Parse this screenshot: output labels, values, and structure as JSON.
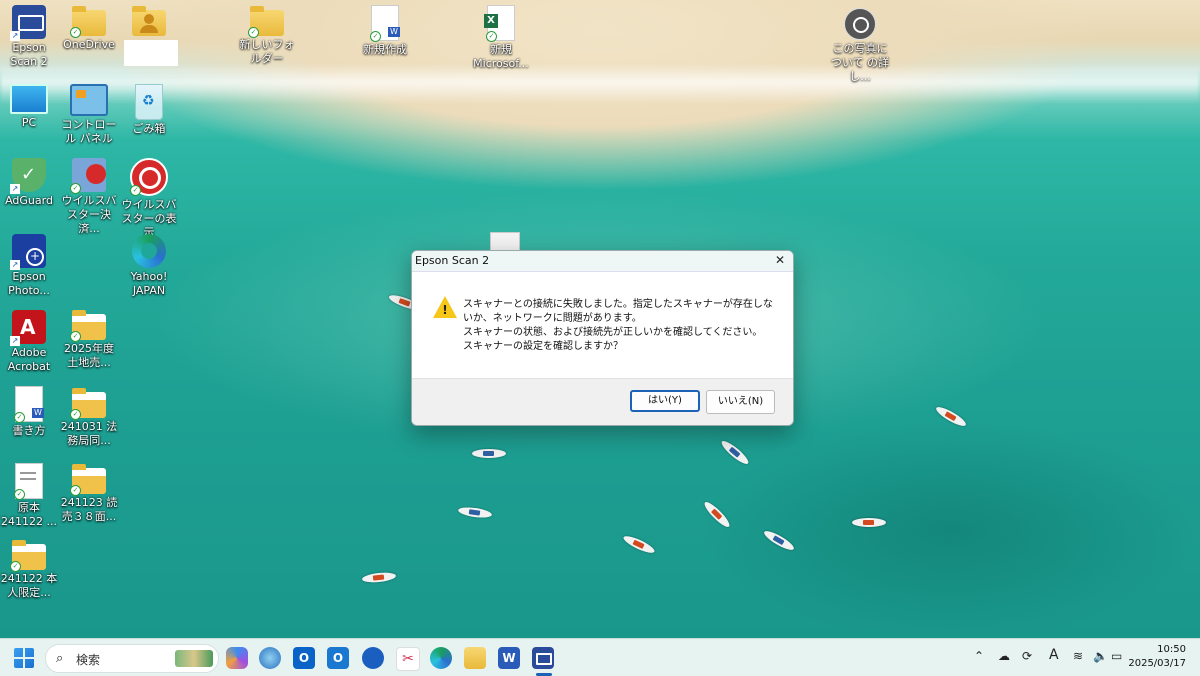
{
  "desktop": {
    "icons": [
      {
        "id": "epson-scan",
        "label": "Epson Scan 2"
      },
      {
        "id": "onedrive",
        "label": "OneDrive"
      },
      {
        "id": "new-folder",
        "label": "新しいフォルダー"
      },
      {
        "id": "new-doc",
        "label": "新規作成"
      },
      {
        "id": "new-excel",
        "label": "新規 Microsof..."
      },
      {
        "id": "photo-info",
        "label": "この写真について の詳し..."
      },
      {
        "id": "pc",
        "label": "PC"
      },
      {
        "id": "control-panel",
        "label": "コントロール パネル"
      },
      {
        "id": "recycle-bin",
        "label": "ごみ箱"
      },
      {
        "id": "adguard",
        "label": "AdGuard"
      },
      {
        "id": "virusbuster-pay",
        "label": "ウイルスバスター決済..."
      },
      {
        "id": "virusbuster-show",
        "label": "ウイルスバスターの表示"
      },
      {
        "id": "epson-photo",
        "label": "Epson Photo..."
      },
      {
        "id": "yahoo",
        "label": "Yahoo! JAPAN"
      },
      {
        "id": "adobe",
        "label": "Adobe Acrobat"
      },
      {
        "id": "folder-2025",
        "label": "2025年度 土地売..."
      },
      {
        "id": "kakikata",
        "label": "書き方"
      },
      {
        "id": "folder-241031",
        "label": "241031 法務局同..."
      },
      {
        "id": "gen-hon",
        "label": "原本 241122 ..."
      },
      {
        "id": "folder-241123",
        "label": "241123 読売３８面..."
      },
      {
        "id": "folder-241122",
        "label": "241122 本人限定..."
      }
    ]
  },
  "dialog": {
    "title": "Epson Scan 2",
    "close": "✕",
    "message_line1": "スキャナーとの接続に失敗しました。指定したスキャナーが存在しないか、ネットワークに問題があります。",
    "message_line2": "スキャナーの状態、および接続先が正しいかを確認してください。",
    "message_line3": "スキャナーの設定を確認しますか？",
    "yes_label": "はい(Y)",
    "no_label": "いいえ(N)"
  },
  "taskbar": {
    "search_placeholder": "検索",
    "ime_label": "A",
    "time": "10:50",
    "date": "2025/03/17"
  },
  "colors": {
    "accent": "#1c63b7",
    "warning": "#f6c619",
    "taskbar": "#e6f3f1"
  }
}
